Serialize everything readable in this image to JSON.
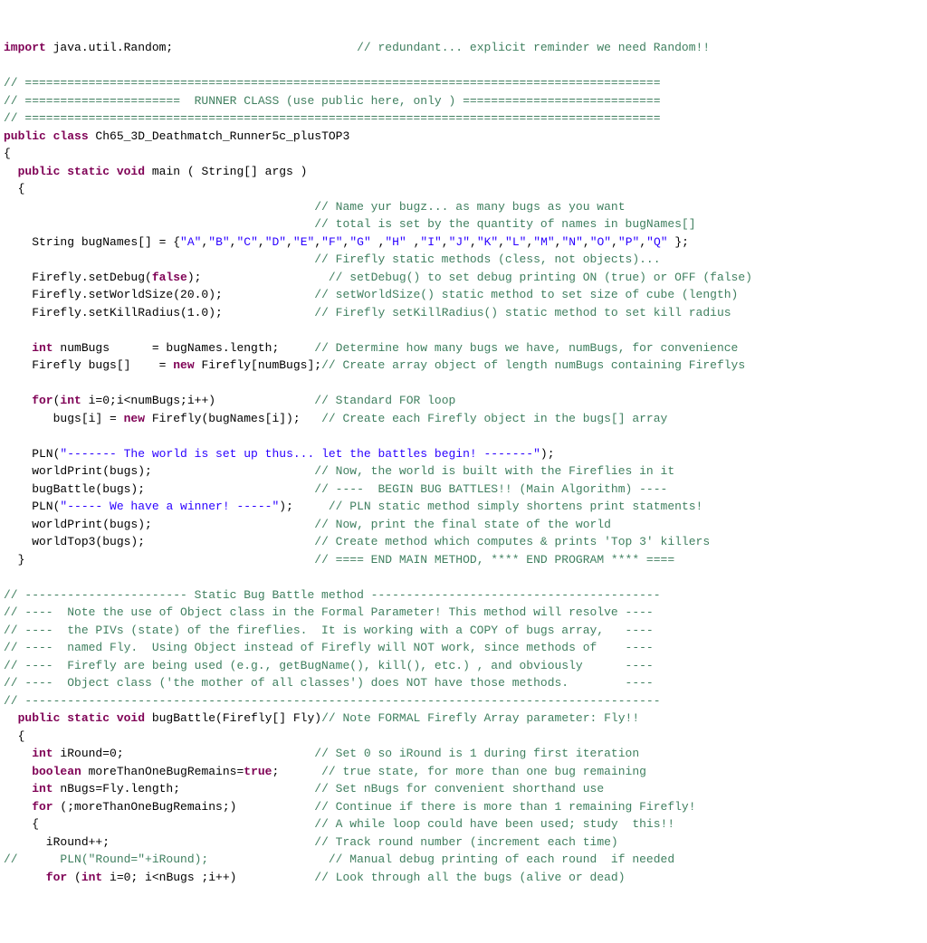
{
  "code": {
    "l01a": "import",
    "l01b": " java.util.Random;                          ",
    "l01c": "// redundant... explicit reminder we need Random!!",
    "l03": "// ==========================================================================================",
    "l04": "// ======================  RUNNER CLASS (use public here, only ) ============================",
    "l05": "// ==========================================================================================",
    "l06a": "public class",
    "l06b": " Ch65_3D_Deathmatch_Runner5c_plusTOP3",
    "l07": "{",
    "l08a": "  public static void",
    "l08b": " main ( String[] args )",
    "l09": "  {",
    "l10": "                                            // Name yur bugz... as many bugs as you want",
    "l11": "                                            // total is set by the quantity of names in bugNames[]",
    "l12a": "    String bugNames[] = {",
    "l12b": "\"A\"",
    "l12c": ",",
    "l12d": "\"B\"",
    "l12e": ",",
    "l12f": "\"C\"",
    "l12g": ",",
    "l12h": "\"D\"",
    "l12i": ",",
    "l12j": "\"E\"",
    "l12k": ",",
    "l12l": "\"F\"",
    "l12m": ",",
    "l12n": "\"G\"",
    "l12o": " ,",
    "l12p": "\"H\"",
    "l12q": " ,",
    "l12r": "\"I\"",
    "l12s": ",",
    "l12t": "\"J\"",
    "l12u": ",",
    "l12v": "\"K\"",
    "l12w": ",",
    "l12x": "\"L\"",
    "l12y": ",",
    "l12z": "\"M\"",
    "l12aa": ",",
    "l12ab": "\"N\"",
    "l12ac": ",",
    "l12ad": "\"O\"",
    "l12ae": ",",
    "l12af": "\"P\"",
    "l12ag": ",",
    "l12ah": "\"Q\"",
    "l12ai": " };",
    "l13": "                                            // Firefly static methods (cless, not objects)...",
    "l14a": "    Firefly.setDebug(",
    "l14b": "false",
    "l14c": ");                  ",
    "l14d": "// setDebug() to set debug printing ON (true) or OFF (false)",
    "l15a": "    Firefly.setWorldSize(20.0);             ",
    "l15b": "// setWorldSize() static method to set size of cube (length)",
    "l16a": "    Firefly.setKillRadius(1.0);             ",
    "l16b": "// Firefly setKillRadius() static method to set kill radius",
    "l18a": "    int",
    "l18b": " numBugs      = bugNames.length;     ",
    "l18c": "// Determine how many bugs we have, numBugs, for convenience",
    "l19a": "    Firefly bugs[]    = ",
    "l19b": "new",
    "l19c": " Firefly[numBugs];",
    "l19d": "// Create array object of length numBugs containing Fireflys",
    "l21a": "    for",
    "l21b": "(",
    "l21c": "int",
    "l21d": " i=0;i<numBugs;i++)              ",
    "l21e": "// Standard FOR loop",
    "l22a": "       bugs[i] = ",
    "l22b": "new",
    "l22c": " Firefly(bugNames[i]);   ",
    "l22d": "// Create each Firefly object in the bugs[] array",
    "l24a": "    PLN(",
    "l24b": "\"------- The world is set up thus... let the battles begin! -------\"",
    "l24c": ");",
    "l25a": "    worldPrint(bugs);                       ",
    "l25b": "// Now, the world is built with the Fireflies in it",
    "l26a": "    bugBattle(bugs);                        ",
    "l26b": "// ----  BEGIN BUG BATTLES!! (Main Algorithm) ----",
    "l27a": "    PLN(",
    "l27b": "\"----- We have a winner! -----\"",
    "l27c": ");     ",
    "l27d": "// PLN static method simply shortens print statments!",
    "l28a": "    worldPrint(bugs);                       ",
    "l28b": "// Now, print the final state of the world",
    "l29a": "    worldTop3(bugs);                        ",
    "l29b": "// Create method which computes & prints 'Top 3' killers",
    "l30a": "  }                                         ",
    "l30b": "// ==== END MAIN METHOD, **** END PROGRAM **** ====",
    "l32": "// ----------------------- Static Bug Battle method -----------------------------------------",
    "l33": "// ----  Note the use of Object class in the Formal Parameter! This method will resolve ----",
    "l34": "// ----  the PIVs (state) of the fireflies.  It is working with a COPY of bugs array,   ----",
    "l35": "// ----  named Fly.  Using Object instead of Firefly will NOT work, since methods of    ----",
    "l36": "// ----  Firefly are being used (e.g., getBugName(), kill(), etc.) , and obviously      ----",
    "l37": "// ----  Object class ('the mother of all classes') does NOT have those methods.        ----",
    "l38": "// ------------------------------------------------------------------------------------------",
    "l39a": "  public static void",
    "l39b": " bugBattle(Firefly[] Fly)",
    "l39c": "// Note FORMAL Firefly Array parameter: Fly!!",
    "l40": "  {",
    "l41a": "    int",
    "l41b": " iRound=0;                           ",
    "l41c": "// Set 0 so iRound is 1 during first iteration",
    "l42a": "    boolean",
    "l42b": " moreThanOneBugRemains=",
    "l42c": "true",
    "l42d": ";      ",
    "l42e": "// true state, for more than one bug remaining",
    "l43a": "    int",
    "l43b": " nBugs=Fly.length;                   ",
    "l43c": "// Set nBugs for convenient shorthand use",
    "l44a": "    for",
    "l44b": " (;moreThanOneBugRemains;)           ",
    "l44c": "// Continue if there is more than 1 remaining Firefly!",
    "l45a": "    {                                       ",
    "l45b": "// A while loop could have been used; study  this!!",
    "l46a": "      iRound++;                             ",
    "l46b": "// Track round number (increment each time)",
    "l47a": "//      PLN(\"Round=\"+iRound);                 ",
    "l47b": "// Manual debug printing of each round  if needed",
    "l48a": "      for",
    "l48b": " (",
    "l48c": "int",
    "l48d": " i=0; i<nBugs ;i++)           ",
    "l48e": "// Look through all the bugs (alive or dead)"
  }
}
